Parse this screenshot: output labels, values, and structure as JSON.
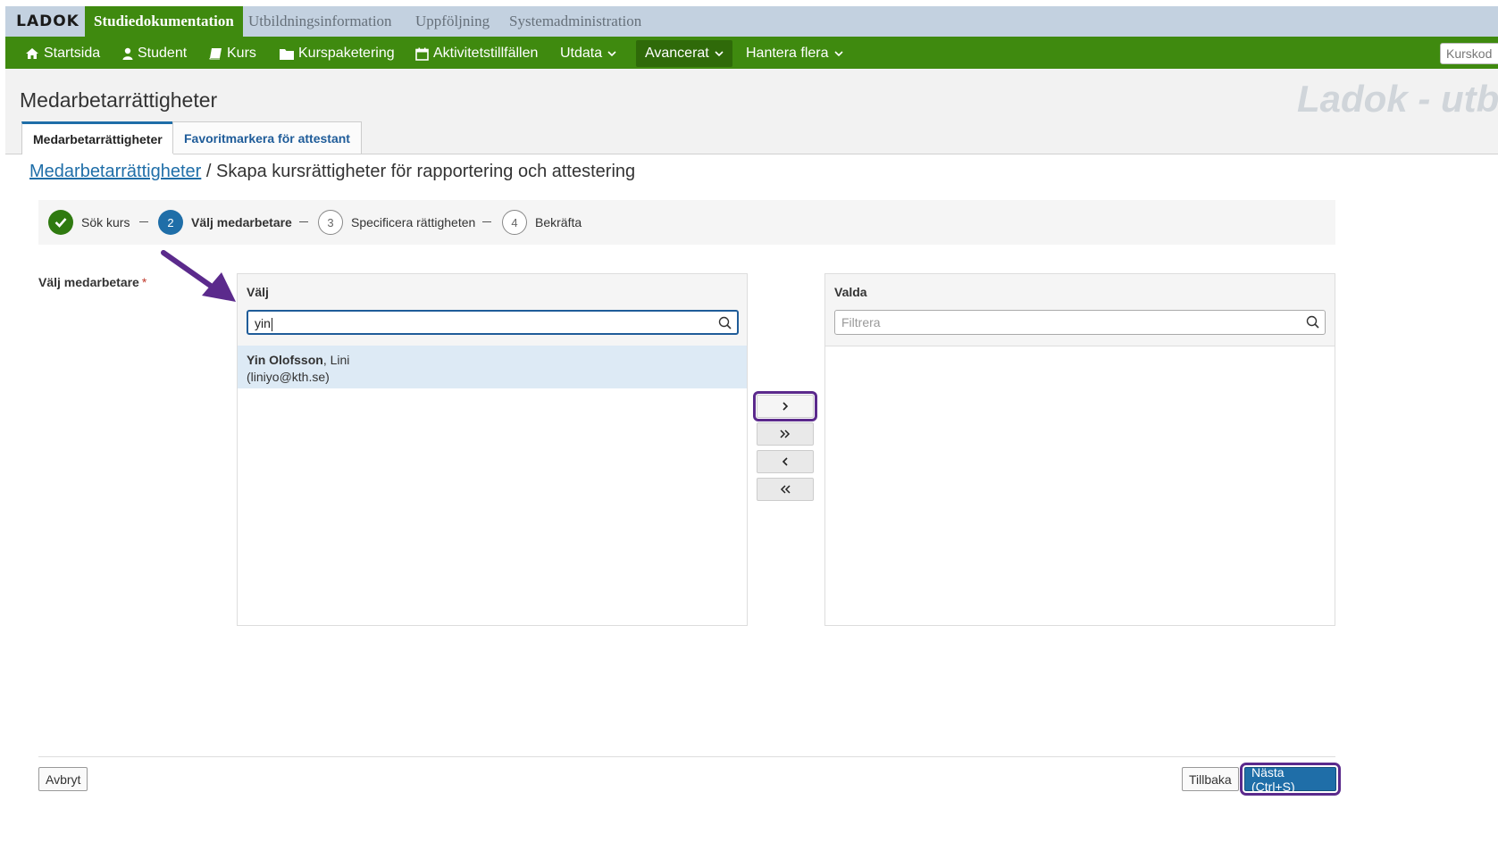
{
  "app": {
    "logo": "LADOK",
    "top_tabs": [
      "Studiedokumentation",
      "Utbildningsinformation",
      "Uppföljning",
      "Systemadministration"
    ],
    "active_top_tab": "Studiedokumentation"
  },
  "nav": {
    "items": [
      {
        "label": "Startsida",
        "icon": "home-icon"
      },
      {
        "label": "Student",
        "icon": "user-icon"
      },
      {
        "label": "Kurs",
        "icon": "book-icon"
      },
      {
        "label": "Kurspaketering",
        "icon": "folder-icon"
      },
      {
        "label": "Aktivitetstillfällen",
        "icon": "calendar-icon"
      },
      {
        "label": "Utdata",
        "icon": "chevron-down-icon"
      },
      {
        "label": "Avancerat",
        "icon": "chevron-down-icon"
      },
      {
        "label": "Hantera flera",
        "icon": "chevron-down-icon"
      }
    ],
    "active": "Avancerat",
    "search_placeholder": "Kurskod"
  },
  "page": {
    "title": "Medarbetarrättigheter",
    "watermark": "Ladok - utb",
    "tabs": [
      "Medarbetarrättigheter",
      "Favoritmarkera för attestant"
    ],
    "active_tab": "Medarbetarrättigheter",
    "breadcrumb": {
      "link": "Medarbetarrättigheter",
      "separator": " / ",
      "current": "Skapa kursrättigheter för rapportering och attestering"
    }
  },
  "stepper": {
    "steps": [
      {
        "number": "1",
        "label": "Sök kurs",
        "state": "done"
      },
      {
        "number": "2",
        "label": "Välj medarbetare",
        "state": "current"
      },
      {
        "number": "3",
        "label": "Specificera rättigheten",
        "state": "todo"
      },
      {
        "number": "4",
        "label": "Bekräfta",
        "state": "todo"
      }
    ],
    "separator": "—"
  },
  "form": {
    "label": "Välj medarbetare",
    "required_marker": "*",
    "left_panel": {
      "title": "Välj",
      "search_value": "yin",
      "results": [
        {
          "name_bold": "Yin Olofsson",
          "name_rest": ", Lini",
          "email": "(liniyo@kth.se)"
        }
      ]
    },
    "right_panel": {
      "title": "Valda",
      "filter_placeholder": "Filtrera"
    },
    "transfer_buttons": [
      ">",
      ">>",
      "<",
      "<<"
    ]
  },
  "footer": {
    "cancel": "Avbryt",
    "back": "Tillbaka",
    "next": "Nästa (Ctrl+S)"
  },
  "colors": {
    "nav_green": "#3f8a0f",
    "primary_blue": "#1f6ea8",
    "highlight_purple": "#5b2a8c"
  }
}
